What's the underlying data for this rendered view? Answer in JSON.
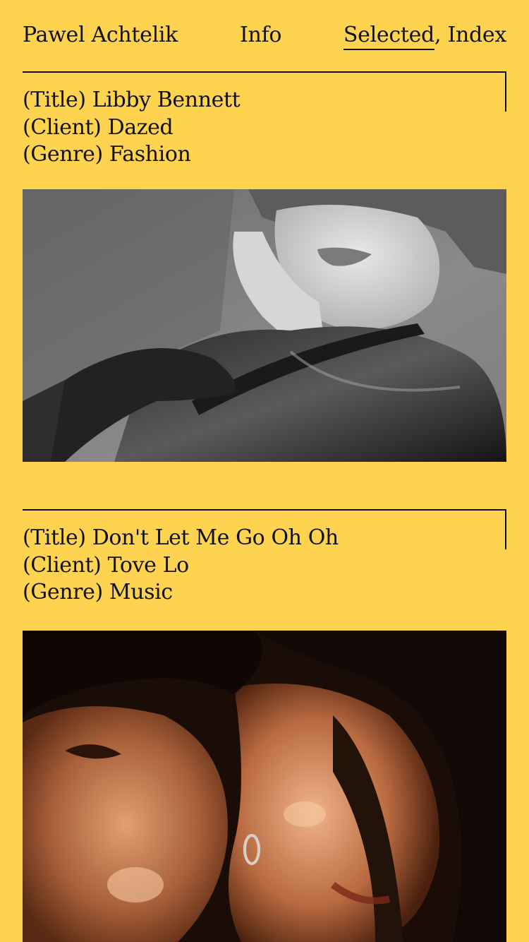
{
  "nav": {
    "name": "Pawel Achtelik",
    "info": "Info",
    "selected": "Selected",
    "separator": ",",
    "index": "Index"
  },
  "projects": [
    {
      "title_label": "(Title)",
      "title": "Libby Bennett",
      "client_label": "(Client)",
      "client": "Dazed",
      "genre_label": "(Genre)",
      "genre": "Fashion",
      "image": "black-and-white fashion photo of a person in a glossy leather jacket"
    },
    {
      "title_label": "(Title)",
      "title": "Don't Let Me Go Oh Oh",
      "client_label": "(Client)",
      "client": "Tove Lo",
      "genre_label": "(Genre)",
      "genre": "Music",
      "image": "warm-toned close-up of two faces with a nose ring"
    }
  ],
  "colors": {
    "background": "#FDD34F",
    "text": "#111111"
  }
}
